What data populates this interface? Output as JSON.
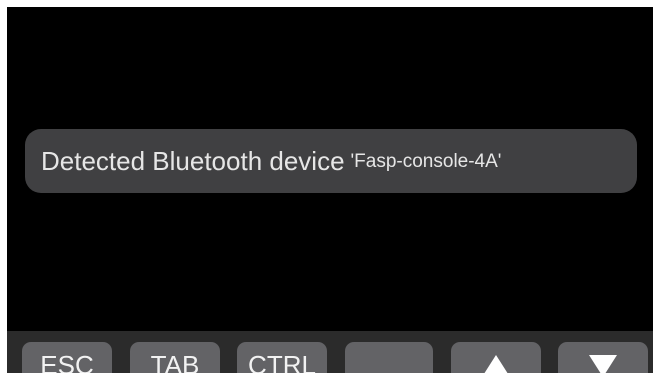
{
  "toast": {
    "message": "Detected Bluetooth device",
    "device_name": "'Fasp-console-4A'"
  },
  "keybar": {
    "keys": [
      "ESC",
      "TAB",
      "CTRL",
      "",
      "up-arrow-icon",
      "down-arrow-icon"
    ]
  }
}
